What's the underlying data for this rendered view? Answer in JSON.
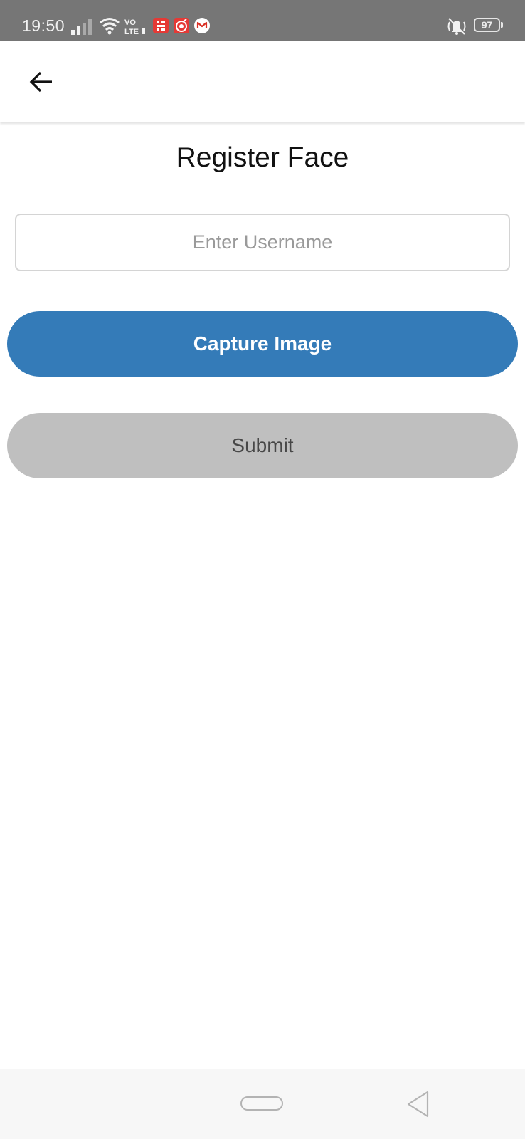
{
  "status_bar": {
    "time": "19:50",
    "battery_level": "97",
    "icons": [
      "signal-icon",
      "wifi-icon",
      "volte-icon",
      "app-icon",
      "app-icon",
      "gmail-icon",
      "vibrate-icon",
      "battery-icon"
    ],
    "colors": {
      "background": "#767676",
      "foreground": "#f2f2f2",
      "app_icon_red": "#e53935"
    }
  },
  "app_bar": {
    "back_icon": "arrow-left-icon"
  },
  "main": {
    "title": "Register Face",
    "username_input": {
      "placeholder": "Enter Username",
      "value": ""
    },
    "capture_button_label": "Capture Image",
    "submit_button_label": "Submit",
    "colors": {
      "capture_button": "#347bb8",
      "submit_button": "#bfbfbf"
    }
  },
  "nav_bar": {
    "home_icon": "home-pill-icon",
    "back_icon": "triangle-back-icon"
  }
}
